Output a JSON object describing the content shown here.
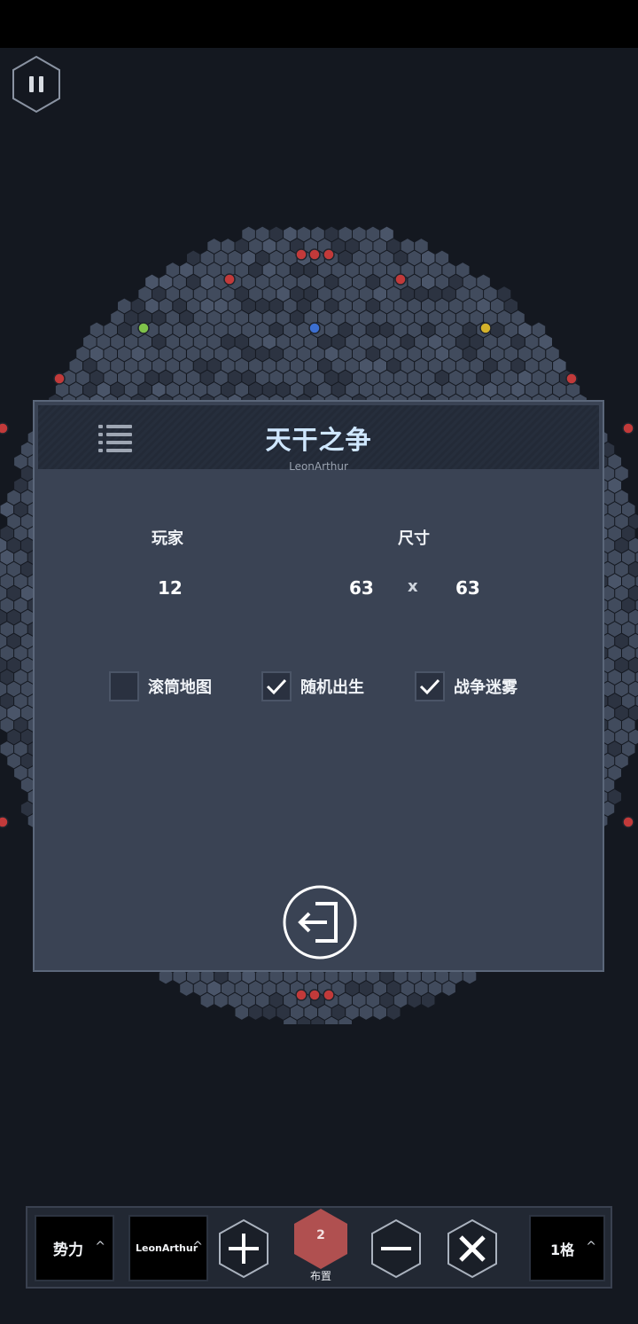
{
  "hud": {
    "pause_icon": "pause-icon"
  },
  "dialog": {
    "title": "天干之争",
    "author": "LeonArthur",
    "players_label": "玩家",
    "size_label": "尺寸",
    "players_value": "12",
    "width_value": "63",
    "times": "x",
    "height_value": "63",
    "options": [
      {
        "label": "滚筒地图",
        "checked": false
      },
      {
        "label": "随机出生",
        "checked": true
      },
      {
        "label": "战争迷雾",
        "checked": true
      }
    ],
    "exit_icon": "exit-icon",
    "menu_icon": "list-icon"
  },
  "toolbar": {
    "faction_label": "势力",
    "player_label": "LeonArthur",
    "place_count": "2",
    "place_label": "布置",
    "step_label": "1格"
  },
  "colors": {
    "background": "#141820",
    "panel": "#3a4354",
    "title": "#cfe7ff",
    "badge": "#b05050",
    "hex_fill": "#414b5d"
  }
}
